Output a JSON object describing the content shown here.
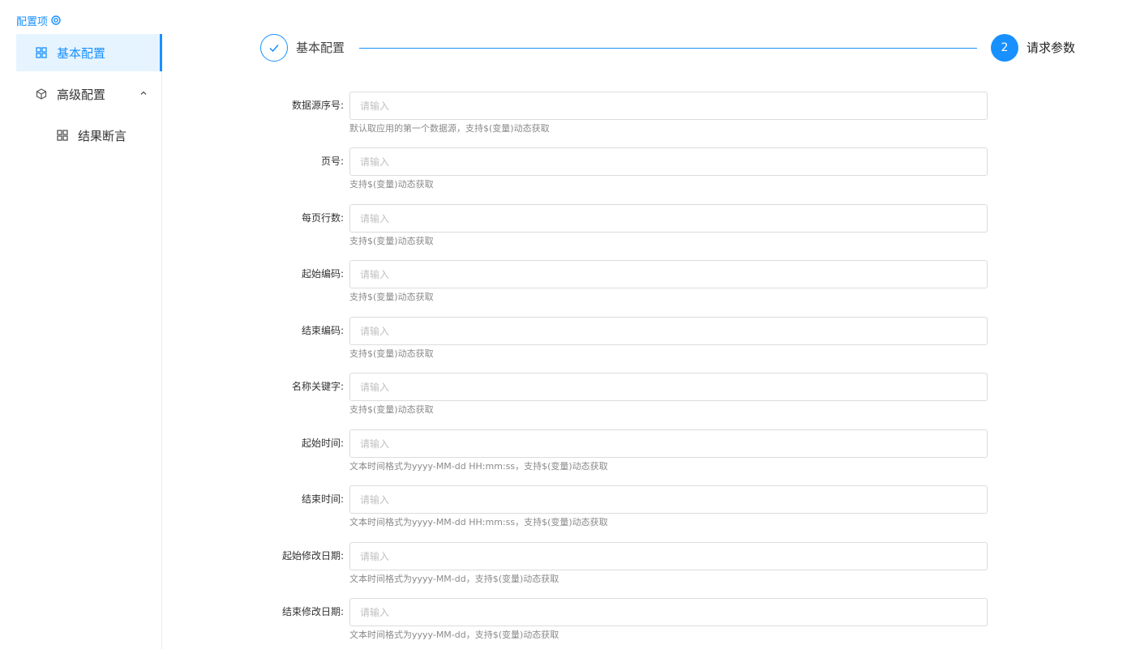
{
  "sidebar": {
    "header": "配置项",
    "items": [
      {
        "label": "基本配置",
        "icon": "grid-icon",
        "active": true
      },
      {
        "label": "高级配置",
        "icon": "cube-icon",
        "expanded": true
      },
      {
        "label": "结果断言",
        "icon": "grid-icon"
      }
    ]
  },
  "steps": [
    {
      "number": "1",
      "title": "基本配置",
      "status": "finished"
    },
    {
      "number": "2",
      "title": "请求参数",
      "status": "current"
    }
  ],
  "form": {
    "placeholder": "请输入",
    "fields": [
      {
        "label": "数据源序号:",
        "value": "",
        "help": "默认取应用的第一个数据源，支持$(变量)动态获取"
      },
      {
        "label": "页号:",
        "value": "",
        "help": "支持$(变量)动态获取"
      },
      {
        "label": "每页行数:",
        "value": "",
        "help": "支持$(变量)动态获取"
      },
      {
        "label": "起始编码:",
        "value": "",
        "help": "支持$(变量)动态获取"
      },
      {
        "label": "结束编码:",
        "value": "",
        "help": "支持$(变量)动态获取"
      },
      {
        "label": "名称关键字:",
        "value": "",
        "help": "支持$(变量)动态获取"
      },
      {
        "label": "起始时间:",
        "value": "",
        "help": "文本时间格式为yyyy-MM-dd HH:mm:ss，支持$(变量)动态获取"
      },
      {
        "label": "结束时间:",
        "value": "",
        "help": "文本时间格式为yyyy-MM-dd HH:mm:ss，支持$(变量)动态获取"
      },
      {
        "label": "起始修改日期:",
        "value": "",
        "help": "文本时间格式为yyyy-MM-dd，支持$(变量)动态获取"
      },
      {
        "label": "结束修改日期:",
        "value": "",
        "help": "文本时间格式为yyyy-MM-dd，支持$(变量)动态获取"
      }
    ]
  },
  "colors": {
    "accent": "#1890ff",
    "active_bg": "#e6f4ff",
    "border": "#dcdcdc",
    "help_text": "#8a8a8a"
  }
}
